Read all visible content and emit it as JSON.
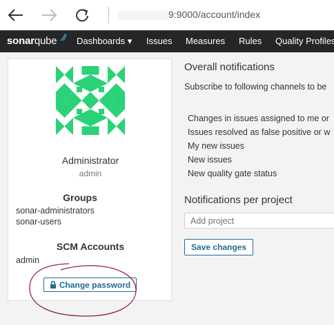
{
  "browser": {
    "url": "9:9000/account/index",
    "back_icon": "back-arrow-icon",
    "forward_icon": "forward-arrow-icon",
    "refresh_icon": "refresh-icon"
  },
  "nav": {
    "logo_text_bold": "sonar",
    "logo_text_light": "qube",
    "items": [
      "Dashboards ▾",
      "Issues",
      "Measures",
      "Rules",
      "Quality Profiles"
    ]
  },
  "profile": {
    "name": "Administrator",
    "login": "admin",
    "groups_title": "Groups",
    "groups": [
      "sonar-administrators",
      "sonar-users"
    ],
    "scm_title": "SCM Accounts",
    "scm_accounts": [
      "admin"
    ],
    "change_password_label": "Change password",
    "avatar_color": "#2ad278"
  },
  "notifications": {
    "overall_title": "Overall notifications",
    "subscribe_text": "Subscribe to following channels to be",
    "items": [
      "Changes in issues assigned to me or",
      "Issues resolved as false positive or w",
      "My new issues",
      "New issues",
      "New quality gate status"
    ],
    "per_project_title": "Notifications per project",
    "add_project_placeholder": "Add project",
    "save_label": "Save changes"
  },
  "colors": {
    "accent": "#236a97",
    "nav_bg": "#262626",
    "annotation_circle": "#8b2252"
  }
}
